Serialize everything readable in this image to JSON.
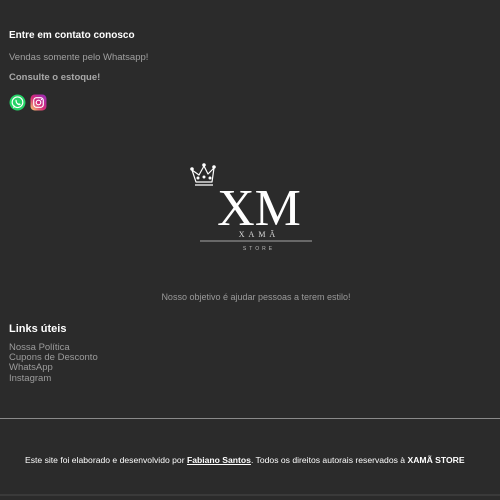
{
  "contact": {
    "heading": "Entre em contato conosco",
    "sales_note": "Vendas somente pelo Whatsapp!",
    "stock_note": "Consulte o estoque!",
    "social_icons": [
      "whatsapp-icon",
      "instagram-icon"
    ]
  },
  "brand": {
    "logo_letters": "XM",
    "logo_name": "XAMÃ",
    "logo_sub": "STORE",
    "tagline": "Nosso objetivo é ajudar pessoas a terem estilo!"
  },
  "links": {
    "heading": "Links úteis",
    "items": [
      "Nossa Política",
      "Cupons de Desconto",
      "WhatsApp",
      "Instagram"
    ]
  },
  "footer": {
    "prefix": "Este site foi elaborado e desenvolvido por ",
    "author": "Fabiano Santos",
    "middle": ". Todos os direitos autorais reservados à ",
    "store": "XAMÃ STORE"
  },
  "colors": {
    "background": "#2b2b2b",
    "whatsapp": "#25d366",
    "instagram_gradient": [
      "#feda75",
      "#d62976",
      "#962fbf"
    ]
  }
}
